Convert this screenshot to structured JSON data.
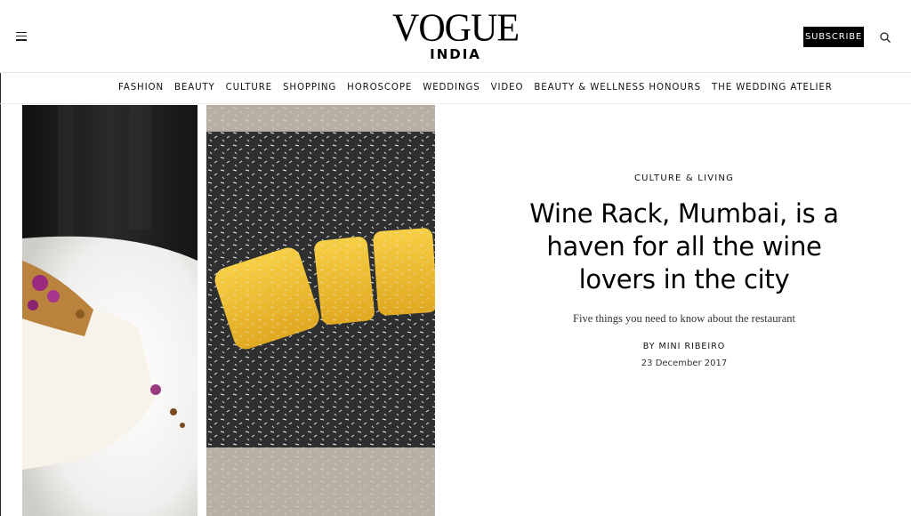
{
  "header": {
    "logo_main": "VOGUE",
    "logo_sub": "INDIA",
    "subscribe_label": "SUBSCRIBE",
    "menu_icon": "hamburger-menu-icon",
    "search_icon": "search-icon"
  },
  "nav": {
    "items": [
      {
        "label": "FASHION"
      },
      {
        "label": "BEAUTY"
      },
      {
        "label": "CULTURE"
      },
      {
        "label": "SHOPPING"
      },
      {
        "label": "HOROSCOPE"
      },
      {
        "label": "WEDDINGS"
      },
      {
        "label": "VIDEO"
      },
      {
        "label": "BEAUTY & WELLNESS HONOURS"
      },
      {
        "label": "THE WEDDING ATELIER"
      }
    ]
  },
  "article": {
    "category": "CULTURE & LIVING",
    "headline": "Wine Rack, Mumbai, is a haven for all the wine lovers in the city",
    "dek": "Five things you need to know about the restaurant",
    "byline": "BY MINI RIBEIRO",
    "date": "23 December 2017"
  },
  "colors": {
    "background": "#ffffff",
    "text": "#111111",
    "subscribe_bg": "#000000",
    "subscribe_text": "#ffffff"
  }
}
